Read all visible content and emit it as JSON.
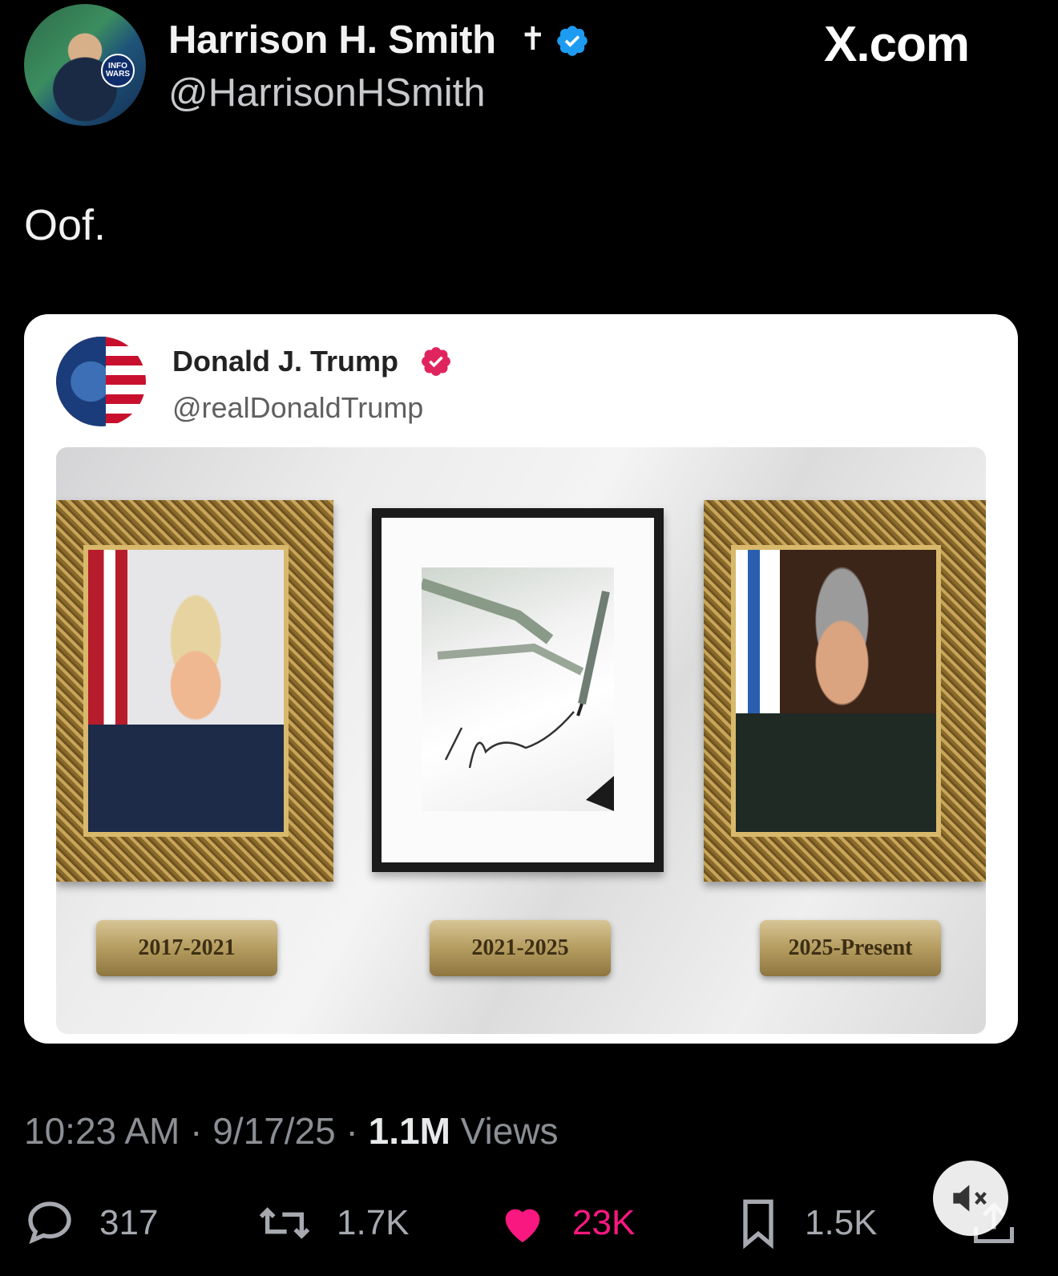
{
  "header": {
    "display_name": "Harrison H. Smith",
    "name_symbol": "✝",
    "handle": "@HarrisonHSmith",
    "avatar_badge": "INFO WARS",
    "site": "X.com"
  },
  "tweet": {
    "text": "Oof."
  },
  "embedded_post": {
    "display_name": "Donald J. Trump",
    "handle": "@realDonaldTrump",
    "plaques": [
      "2017-2021",
      "2021-2025",
      "2025-Present"
    ]
  },
  "meta": {
    "time": "10:23 AM",
    "date": "9/17/25",
    "views_count": "1.1M",
    "views_label": "Views"
  },
  "actions": {
    "replies": "317",
    "reposts": "1.7K",
    "likes": "23K",
    "bookmarks": "1.5K"
  },
  "colors": {
    "verified": "#1d9bf0",
    "like": "#f91880",
    "inner_verified": "#e0245e"
  },
  "icons": [
    "reply-icon",
    "repost-icon",
    "heart-icon",
    "bookmark-icon",
    "share-icon",
    "mute-icon",
    "verified-badge-icon"
  ]
}
